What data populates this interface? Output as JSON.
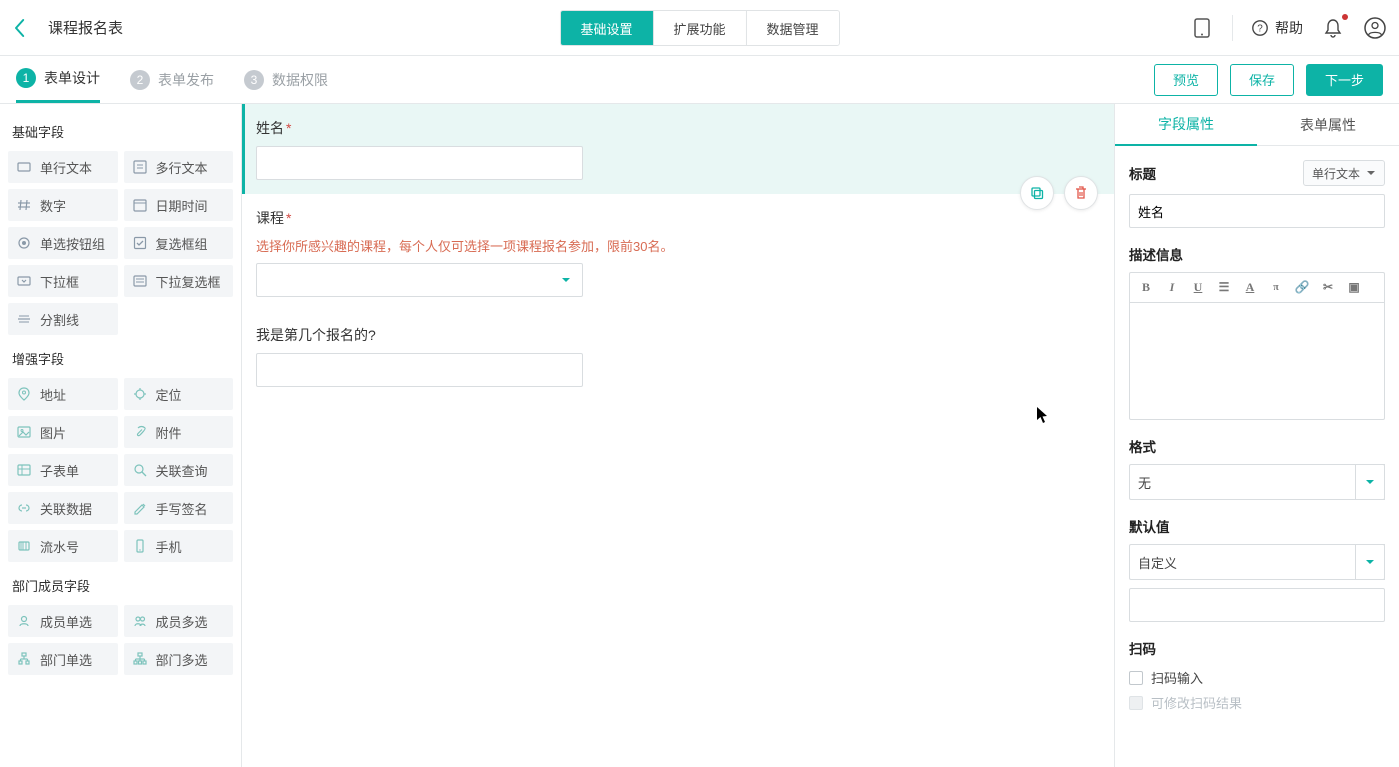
{
  "topbar": {
    "title": "课程报名表",
    "tabs": {
      "basic": "基础设置",
      "extend": "扩展功能",
      "data": "数据管理"
    },
    "help_label": "帮助"
  },
  "subbar": {
    "steps": {
      "s1": "表单设计",
      "s2": "表单发布",
      "s3": "数据权限"
    },
    "buttons": {
      "preview": "预览",
      "save": "保存",
      "next": "下一步"
    }
  },
  "sidebar": {
    "sections": {
      "basic": {
        "title": "基础字段",
        "items": [
          "单行文本",
          "多行文本",
          "数字",
          "日期时间",
          "单选按钮组",
          "复选框组",
          "下拉框",
          "下拉复选框",
          "分割线"
        ]
      },
      "enhanced": {
        "title": "增强字段",
        "items": [
          "地址",
          "定位",
          "图片",
          "附件",
          "子表单",
          "关联查询",
          "关联数据",
          "手写签名",
          "流水号",
          "手机"
        ]
      },
      "dept": {
        "title": "部门成员字段",
        "items": [
          "成员单选",
          "成员多选",
          "部门单选",
          "部门多选"
        ]
      }
    }
  },
  "canvas": {
    "fields": {
      "name": {
        "label": "姓名",
        "required": true
      },
      "course": {
        "label": "课程",
        "required": true,
        "desc": "选择你所感兴趣的课程，每个人仅可选择一项课程报名参加，限前30名。"
      },
      "order": {
        "label": "我是第几个报名的?",
        "required": false
      }
    }
  },
  "panel": {
    "tabs": {
      "field": "字段属性",
      "form": "表单属性"
    },
    "title": {
      "label": "标题",
      "type_label": "单行文本",
      "value": "姓名"
    },
    "desc": {
      "label": "描述信息"
    },
    "format": {
      "label": "格式",
      "value": "无"
    },
    "default": {
      "label": "默认值",
      "value": "自定义"
    },
    "scan": {
      "label": "扫码",
      "opt1": "扫码输入",
      "opt2": "可修改扫码结果"
    }
  }
}
